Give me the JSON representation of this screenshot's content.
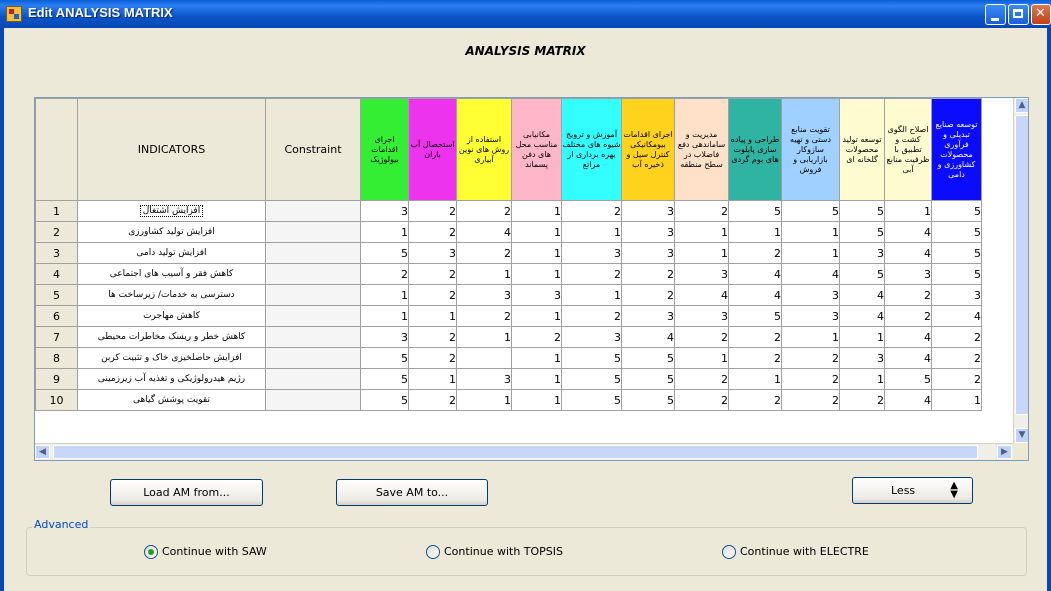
{
  "window": {
    "title": "Edit ANALYSIS MATRIX"
  },
  "heading": "ANALYSIS MATRIX",
  "grid": {
    "col_indicators": "INDICATORS",
    "col_constraint": "Constraint",
    "columns": [
      {
        "label": "اجرای اقدامات بیولوژیک",
        "color": "#33ee33"
      },
      {
        "label": "استحصال آب باران",
        "color": "#ee33ee"
      },
      {
        "label": "استفاده از روش های نوین آبیاری",
        "color": "#ffff33"
      },
      {
        "label": "مکانیابی مناسب محل های دفن پسماند",
        "color": "#ffb6c8"
      },
      {
        "label": "آموزش و ترویج شیوه های مختلف بهره برداری از مراتع",
        "color": "#33ffff"
      },
      {
        "label": "اجرای اقدامات بیومکانیکی کنترل سیل و ذخیره آب",
        "color": "#ffd21e"
      },
      {
        "label": "مدیریت و ساماندهی دفع فاضلاب در سطح منطقه",
        "color": "#ffe0c8"
      },
      {
        "label": "طراحی و پیاده سازی پایلوت های بوم گردی",
        "color": "#2fb3a3"
      },
      {
        "label": "تقویت منابع دستی و تهیه سازوکار بازاریابی و فروش",
        "color": "#9fd0ff"
      },
      {
        "label": "توسعه تولید محصولات گلخانه ای",
        "color": "#fffbd0"
      },
      {
        "label": "اصلاح الگوی کشت و تطبیق با ظرفیت منابع آبی",
        "color": "#fffbd0"
      },
      {
        "label": "توسعه صنایع تبدیلی و فرآوری محصولات کشاورزی و دامی",
        "color": "#0b0bff"
      }
    ],
    "rows": [
      {
        "num": "1",
        "indicator": "افزایش اشتغال",
        "values": [
          "3",
          "2",
          "2",
          "1",
          "2",
          "3",
          "2",
          "5",
          "5",
          "5",
          "1",
          "5"
        ]
      },
      {
        "num": "2",
        "indicator": "افزایش تولید کشاورزی",
        "values": [
          "1",
          "2",
          "4",
          "1",
          "1",
          "3",
          "1",
          "1",
          "1",
          "5",
          "4",
          "5"
        ]
      },
      {
        "num": "3",
        "indicator": "افزایش تولید دامی",
        "values": [
          "5",
          "3",
          "2",
          "1",
          "3",
          "3",
          "1",
          "2",
          "1",
          "3",
          "4",
          "5"
        ]
      },
      {
        "num": "4",
        "indicator": "کاهش فقر و آسیب های اجتماعی",
        "values": [
          "2",
          "2",
          "1",
          "1",
          "2",
          "2",
          "3",
          "4",
          "4",
          "5",
          "3",
          "5"
        ]
      },
      {
        "num": "5",
        "indicator": "دسترسی به خدمات/ زیرساخت ها",
        "values": [
          "1",
          "2",
          "3",
          "3",
          "1",
          "2",
          "4",
          "4",
          "3",
          "4",
          "2",
          "3"
        ]
      },
      {
        "num": "6",
        "indicator": "کاهش مهاجرت",
        "values": [
          "1",
          "1",
          "2",
          "1",
          "2",
          "3",
          "3",
          "5",
          "3",
          "4",
          "2",
          "4"
        ]
      },
      {
        "num": "7",
        "indicator": "کاهش خطر و ریسک مخاطرات محیطی",
        "values": [
          "3",
          "2",
          "1",
          "2",
          "3",
          "4",
          "2",
          "2",
          "1",
          "1",
          "4",
          "2"
        ]
      },
      {
        "num": "8",
        "indicator": "افزایش حاصلخیزی خاک و تثبیت کربن",
        "values": [
          "5",
          "2",
          "",
          "1",
          "5",
          "5",
          "1",
          "2",
          "2",
          "3",
          "4",
          "2"
        ]
      },
      {
        "num": "9",
        "indicator": "رژیم هیدرولوژیکی و تغذیه آب زیرزمینی",
        "values": [
          "5",
          "1",
          "3",
          "1",
          "5",
          "5",
          "2",
          "1",
          "2",
          "1",
          "5",
          "2"
        ]
      },
      {
        "num": "10",
        "indicator": "تقویت پوشش گیاهی",
        "values": [
          "5",
          "2",
          "1",
          "1",
          "5",
          "5",
          "2",
          "2",
          "2",
          "2",
          "4",
          "1"
        ]
      }
    ]
  },
  "buttons": {
    "load": "Load AM from...",
    "save": "Save AM to...",
    "less": "Less"
  },
  "advanced": {
    "label": "Advanced",
    "options": [
      {
        "label": "Continue with SAW",
        "selected": true
      },
      {
        "label": "Continue with TOPSIS",
        "selected": false
      },
      {
        "label": "Continue with ELECTRE",
        "selected": false
      }
    ]
  }
}
